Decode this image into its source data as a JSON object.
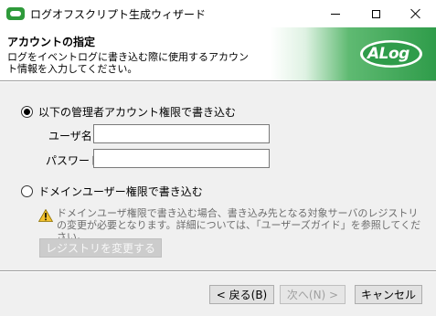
{
  "window": {
    "title": "ログオフスクリプト生成ウィザード",
    "icon": "alog-app-icon"
  },
  "header": {
    "title": "アカウントの指定",
    "description": "ログをイベントログに書き込む際に使用するアカウント情報を入力してください。",
    "logo_text": "ALog",
    "brand_color": "#2f9c4a"
  },
  "options": {
    "admin": {
      "label": "以下の管理者アカウント権限で書き込む",
      "checked": true
    },
    "domain": {
      "label": "ドメインユーザー権限で書き込む",
      "checked": false
    }
  },
  "fields": {
    "username_label": "ユーザ名",
    "username_value": "",
    "password_label": "パスワード",
    "password_value": ""
  },
  "warning": {
    "icon": "warning-icon",
    "text": "ドメインユーザ権限で書き込む場合、書き込み先となる対象サーバのレジストリの変更が必要となります。詳細については、「ユーザーズガイド」を参照してください。"
  },
  "buttons": {
    "registry": "レジストリを変更する",
    "back": "< 戻る(B)",
    "next": "次へ(N) >",
    "cancel": "キャンセル"
  }
}
